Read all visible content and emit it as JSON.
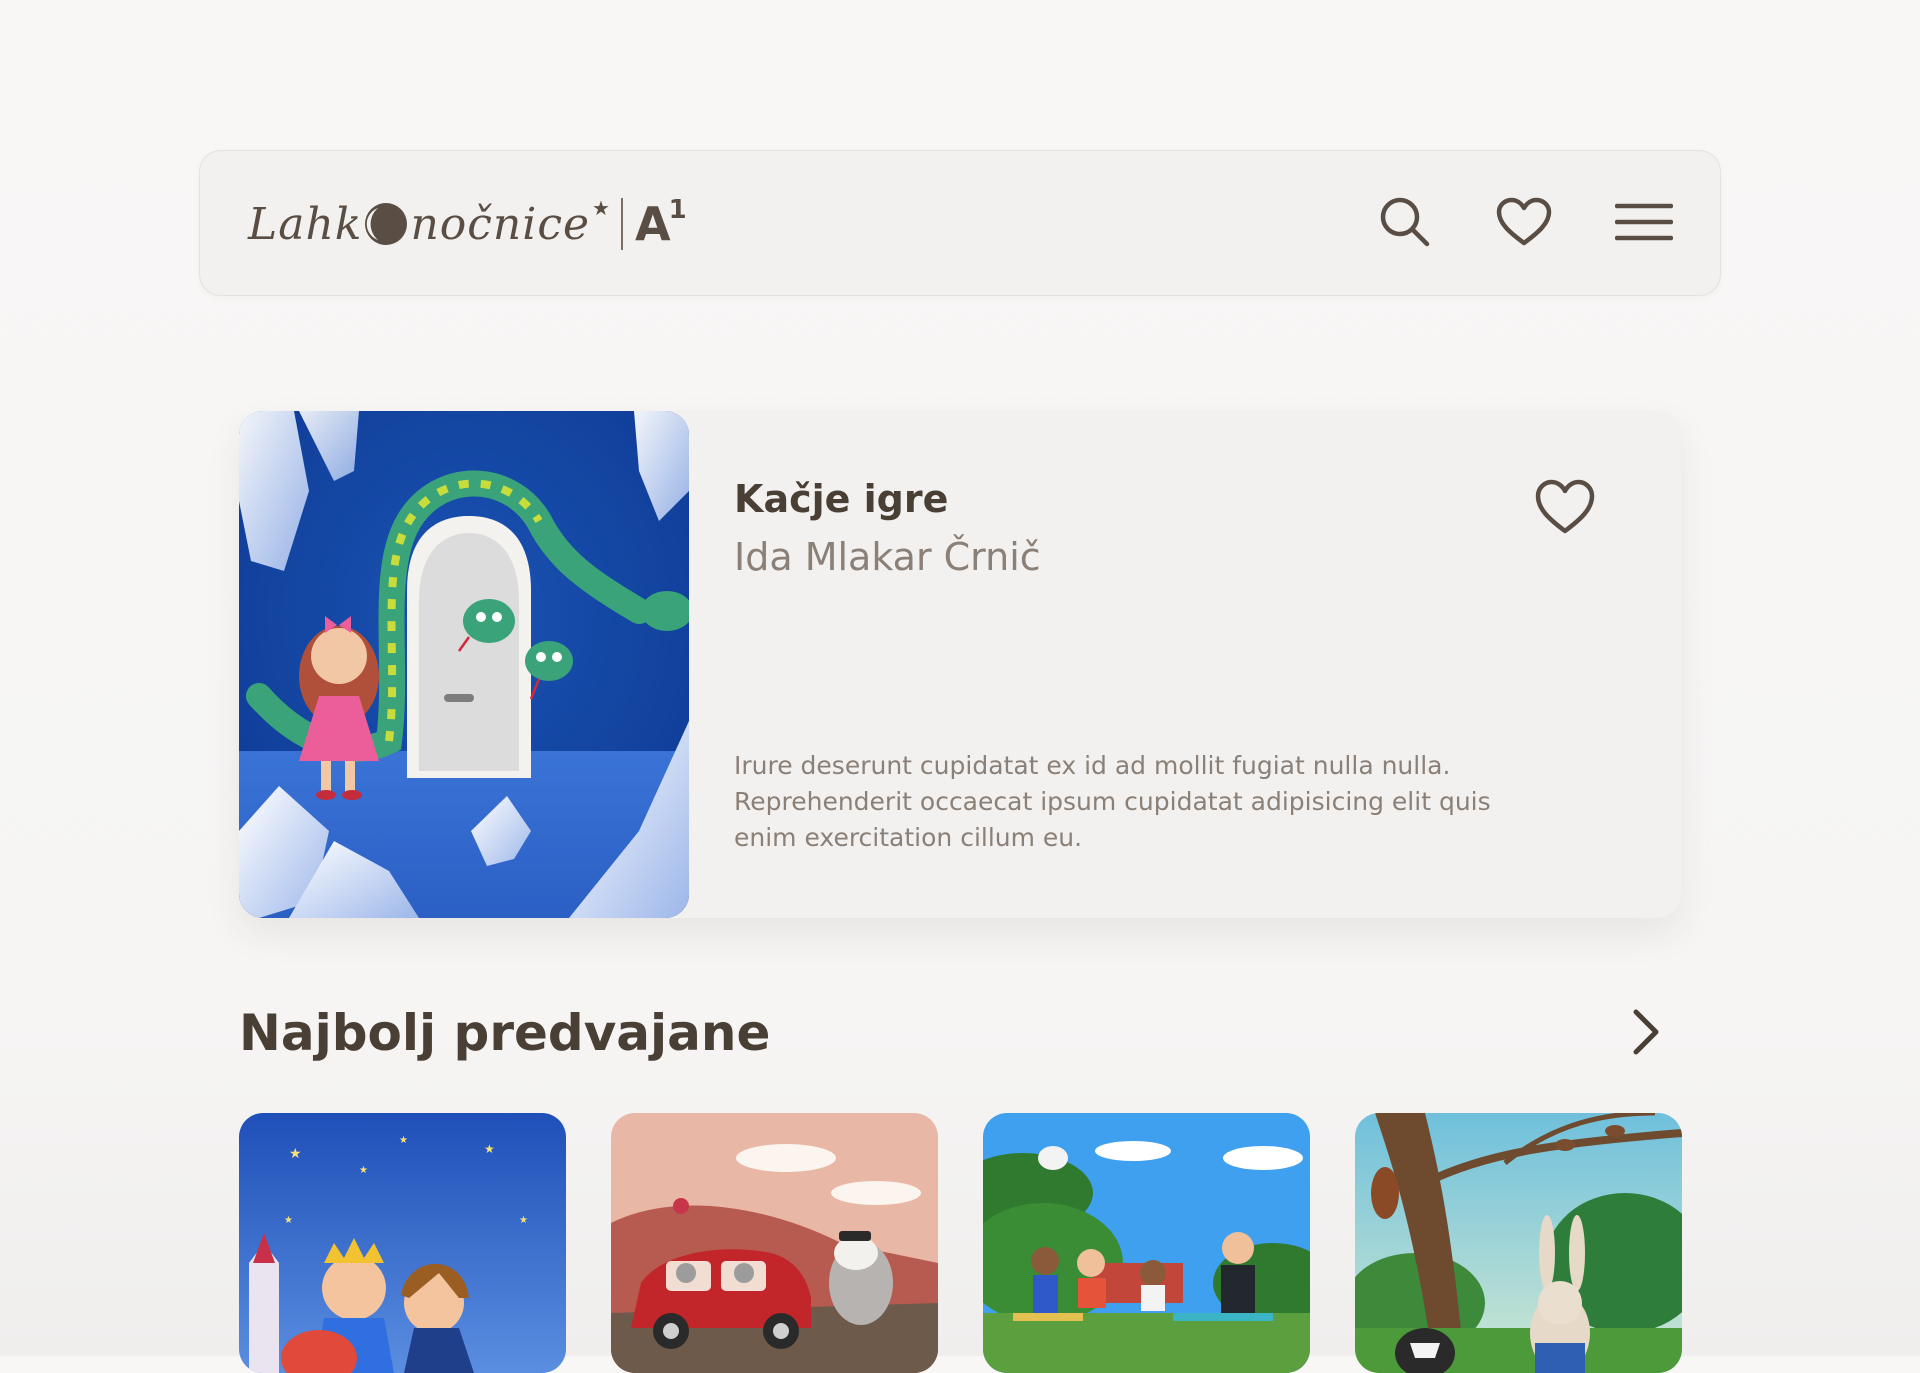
{
  "header": {
    "logo": {
      "brand_text_before": "Lahk",
      "brand_text_after": "nočnice",
      "partner": "A",
      "partner_sup": "1"
    },
    "icons": {
      "search": "search-icon",
      "favorites": "heart-icon",
      "menu": "hamburger-menu-icon"
    }
  },
  "featured": {
    "title": "Kačje igre",
    "author": "Ida Mlakar Črnič",
    "description": "Irure deserunt cupidatat ex id ad mollit fugiat nulla nulla. Reprehenderit occaecat ipsum cupidatat adipisicing elit quis enim exercitation cillum eu.",
    "favorite_icon": "heart-icon"
  },
  "section": {
    "title": "Najbolj predvajane",
    "arrow_icon": "chevron-right-icon"
  },
  "colors": {
    "text_dark": "#4a3f35",
    "text_muted": "#8b8078",
    "card_bg": "#f2f1ef",
    "page_bg": "#f7f6f5"
  }
}
